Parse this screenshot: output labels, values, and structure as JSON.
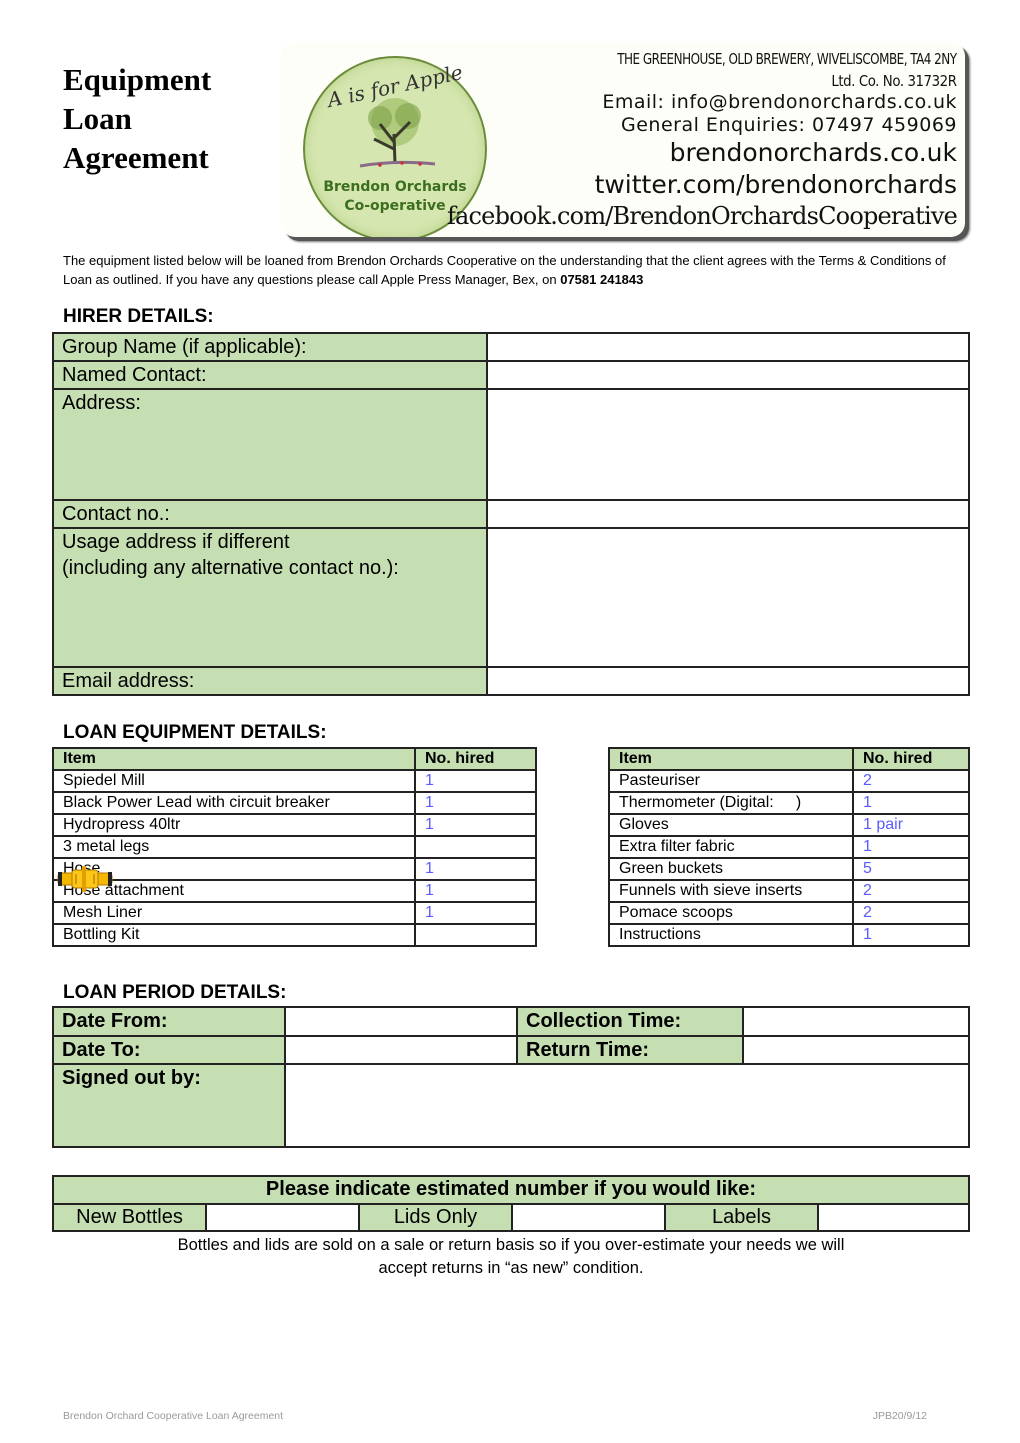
{
  "title_lines": [
    "Equipment",
    "Loan",
    "Agreement"
  ],
  "banner": {
    "logo_top_text": "A is for Apple",
    "logo_bottom_line1": "Brendon Orchards",
    "logo_bottom_line2": "Co-operative",
    "address": "THE GREENHOUSE, OLD BREWERY, WIVELISCOMBE, TA4 2NY",
    "company_no": "Ltd. Co. No. 31732R",
    "email": "Email: info@brendonorchards.co.uk",
    "enquiries": "General Enquiries: 07497 459069",
    "website": "brendonorchards.co.uk",
    "twitter": "twitter.com/brendonorchards",
    "facebook": "facebook.com/BrendonOrchardsCooperative"
  },
  "intro": {
    "text": "The equipment listed below will be loaned from Brendon Orchards Cooperative on the understanding that the client agrees with the Terms & Conditions of Loan as outlined.  If you have any questions please call Apple Press Manager, Bex, on ",
    "phone": "07581 241843"
  },
  "hirer": {
    "heading": "HIRER DETAILS:",
    "fields": [
      {
        "label": "Group Name (if applicable):",
        "value": ""
      },
      {
        "label": "Named Contact:",
        "value": ""
      },
      {
        "label": "Address:",
        "value": ""
      },
      {
        "label": "Contact no.:",
        "value": ""
      },
      {
        "label": "Usage address if different",
        "label2": "(including any alternative contact no.):",
        "value": ""
      },
      {
        "label": "Email address:",
        "value": ""
      }
    ]
  },
  "equipment": {
    "heading": "LOAN EQUIPMENT DETAILS:",
    "col_item": "Item",
    "col_hired": "No. hired",
    "left": [
      {
        "item": "Spiedel Mill",
        "hired": "1"
      },
      {
        "item": "Black Power Lead with circuit breaker",
        "hired": "1"
      },
      {
        "item": "Hydropress 40ltr",
        "hired": "1"
      },
      {
        "item": "3 metal legs",
        "hired": ""
      },
      {
        "item": "Hose",
        "hired": "1"
      },
      {
        "item": "Hose attachment",
        "hired": "1"
      },
      {
        "item": "Mesh Liner",
        "hired": "1"
      },
      {
        "item": "Bottling Kit",
        "hired": ""
      }
    ],
    "right": [
      {
        "item": "Pasteuriser",
        "hired": "2"
      },
      {
        "item": "Thermometer (Digital:     )",
        "hired": "1"
      },
      {
        "item": "Gloves",
        "hired": "1 pair"
      },
      {
        "item": "Extra filter fabric",
        "hired": "1"
      },
      {
        "item": "Green buckets",
        "hired": "5"
      },
      {
        "item": "Funnels with sieve inserts",
        "hired": "2"
      },
      {
        "item": "Pomace scoops",
        "hired": "2"
      },
      {
        "item": "Instructions",
        "hired": "1"
      }
    ]
  },
  "period": {
    "heading": "LOAN PERIOD DETAILS:",
    "date_from": "Date From:",
    "collection_time": "Collection Time:",
    "date_to": "Date To:",
    "return_time": "Return Time:",
    "signed_out_by": "Signed out by:"
  },
  "estimate": {
    "heading": "Please indicate estimated number if you would like:",
    "new_bottles": "New Bottles",
    "lids_only": "Lids Only",
    "labels": "Labels",
    "note_line1": "Bottles and lids are sold on a sale or return basis so if you over-estimate your needs we will",
    "note_line2": "accept returns in “as new” condition."
  },
  "footer": {
    "left": "Brendon Orchard Cooperative Loan Agreement",
    "right": "JPB20/9/12"
  },
  "colors": {
    "label_green": "#c5dfb3",
    "value_blue": "#5b5bff",
    "logo_green": "#3c6e1f"
  }
}
